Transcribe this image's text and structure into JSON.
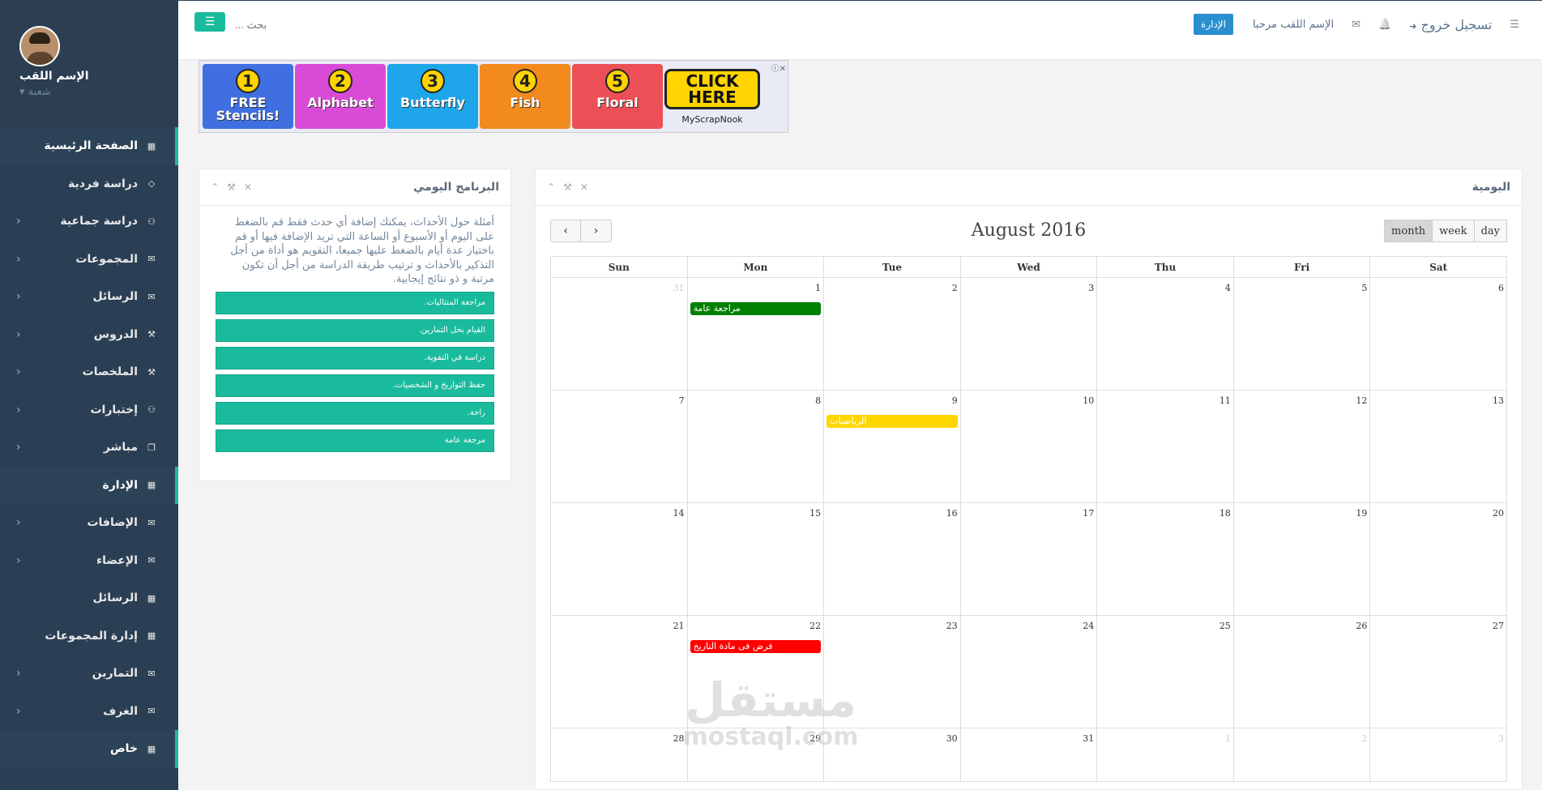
{
  "profile": {
    "name": "الإسم اللقب",
    "role": "شعبة"
  },
  "sidebar": {
    "items": [
      {
        "label": "الصفحة الرئيسية",
        "icon": "grid-icon",
        "glyph": "▦",
        "chevron": "",
        "active": true
      },
      {
        "label": "دراسة فردية",
        "icon": "diamond-icon",
        "glyph": "◇",
        "chevron": "",
        "active": false
      },
      {
        "label": "دراسة جماعية",
        "icon": "sitemap-icon",
        "glyph": "⚇",
        "chevron": "‹",
        "active": false
      },
      {
        "label": "المجموعات",
        "icon": "envelope-icon",
        "glyph": "✉",
        "chevron": "‹",
        "active": false
      },
      {
        "label": "الرسائل",
        "icon": "envelope-icon",
        "glyph": "✉",
        "chevron": "‹",
        "active": false
      },
      {
        "label": "الدروس",
        "icon": "wrench-icon",
        "glyph": "⚒",
        "chevron": "‹",
        "active": false
      },
      {
        "label": "الملخصات",
        "icon": "wrench-icon",
        "glyph": "⚒",
        "chevron": "‹",
        "active": false
      },
      {
        "label": "إختبارات",
        "icon": "sitemap-icon",
        "glyph": "⚇",
        "chevron": "‹",
        "active": false
      },
      {
        "label": "مباشر",
        "icon": "clone-icon",
        "glyph": "❐",
        "chevron": "‹",
        "active": false
      },
      {
        "label": "الإدارة",
        "icon": "grid-icon",
        "glyph": "▦",
        "chevron": "",
        "active": true
      },
      {
        "label": "الإضافات",
        "icon": "envelope-icon",
        "glyph": "✉",
        "chevron": "‹",
        "active": false
      },
      {
        "label": "الإعضاء",
        "icon": "envelope-icon",
        "glyph": "✉",
        "chevron": "‹",
        "active": false
      },
      {
        "label": "الرسائل",
        "icon": "grid-icon",
        "glyph": "▦",
        "chevron": "",
        "active": false
      },
      {
        "label": "إدارة المجموعات",
        "icon": "grid-icon",
        "glyph": "▦",
        "chevron": "",
        "active": false
      },
      {
        "label": "التمارين",
        "icon": "envelope-icon",
        "glyph": "✉",
        "chevron": "‹",
        "active": false
      },
      {
        "label": "الغرف",
        "icon": "envelope-icon",
        "glyph": "✉",
        "chevron": "‹",
        "active": false
      },
      {
        "label": "خاص",
        "icon": "grid-icon",
        "glyph": "▦",
        "chevron": "",
        "active": true
      }
    ]
  },
  "topbar": {
    "menu_glyph": "☰",
    "search_placeholder": "بحث ...",
    "admin_button": "الإدارة",
    "welcome": "الإسم اللقب مرحبا",
    "envelope_glyph": "✉",
    "bell_glyph": "🔔",
    "logout": "تسجيل خروج",
    "logout_glyph": "➜",
    "list_glyph": "☰"
  },
  "ad": {
    "buttons": [
      {
        "num": "1",
        "label": "FREE Stencils!",
        "color": "#3f6fe0"
      },
      {
        "num": "2",
        "label": "Alphabet",
        "color": "#d94bd6"
      },
      {
        "num": "3",
        "label": "Butterfly",
        "color": "#1fa6ea"
      },
      {
        "num": "4",
        "label": "Fish",
        "color": "#f28a1e"
      },
      {
        "num": "5",
        "label": "Floral",
        "color": "#ec4f55"
      }
    ],
    "click": "CLICK HERE",
    "site": "MyScrapNook",
    "close": "ⓘ✕"
  },
  "daily": {
    "title": "البرنامج اليومي",
    "description": "أمثلة حول الأحداث، يمكنك إضافة أي حدث فقط قم بالضغط على اليوم أو الأسبوع أو الساعة التي تريد الإضافة فيها أو قم باختيار عدة أيام بالضغط عليها جميعا، التقويم هو أداة من أجل التذكير بالأحداث و ترتيب طريقة الدراسة من أجل أن تكون مرتبة و ذو نتائج إيجابية.",
    "events": [
      "مراجعة المتتاليات.",
      "القيام بحل التمارين.",
      "دراسة في التفوية.",
      "حفظ التواريخ و الشخصيات.",
      "راحة.",
      "مرجعة عامة"
    ]
  },
  "calendar_panel": {
    "title": "اليومية",
    "month_title": "August 2016",
    "prev": "‹",
    "next": "›",
    "views": [
      "month",
      "week",
      "day"
    ],
    "active_view": "month",
    "weekdays": [
      "Sun",
      "Mon",
      "Tue",
      "Wed",
      "Thu",
      "Fri",
      "Sat"
    ],
    "weeks": [
      [
        {
          "d": "31",
          "o": true
        },
        {
          "d": "1"
        },
        {
          "d": "2"
        },
        {
          "d": "3"
        },
        {
          "d": "4"
        },
        {
          "d": "5"
        },
        {
          "d": "6"
        }
      ],
      [
        {
          "d": "7"
        },
        {
          "d": "8"
        },
        {
          "d": "9"
        },
        {
          "d": "10"
        },
        {
          "d": "11"
        },
        {
          "d": "12"
        },
        {
          "d": "13"
        }
      ],
      [
        {
          "d": "14"
        },
        {
          "d": "15"
        },
        {
          "d": "16"
        },
        {
          "d": "17"
        },
        {
          "d": "18"
        },
        {
          "d": "19"
        },
        {
          "d": "20"
        }
      ],
      [
        {
          "d": "21"
        },
        {
          "d": "22"
        },
        {
          "d": "23"
        },
        {
          "d": "24"
        },
        {
          "d": "25"
        },
        {
          "d": "26"
        },
        {
          "d": "27"
        }
      ],
      [
        {
          "d": "28"
        },
        {
          "d": "29"
        },
        {
          "d": "30"
        },
        {
          "d": "31"
        },
        {
          "d": "1",
          "o": true
        },
        {
          "d": "2",
          "o": true
        },
        {
          "d": "3",
          "o": true
        }
      ]
    ],
    "events": [
      {
        "week": 0,
        "day": 1,
        "title": "مراجعة عامة",
        "color": "#008000"
      },
      {
        "week": 1,
        "day": 2,
        "title": "الرياضيات",
        "color": "#ffd700"
      },
      {
        "week": 3,
        "day": 1,
        "title": "فرض فى مادة التاريخ",
        "color": "#ff0000"
      }
    ]
  },
  "watermark": {
    "arabic": "مستقل",
    "latin": "mostaql.com"
  }
}
